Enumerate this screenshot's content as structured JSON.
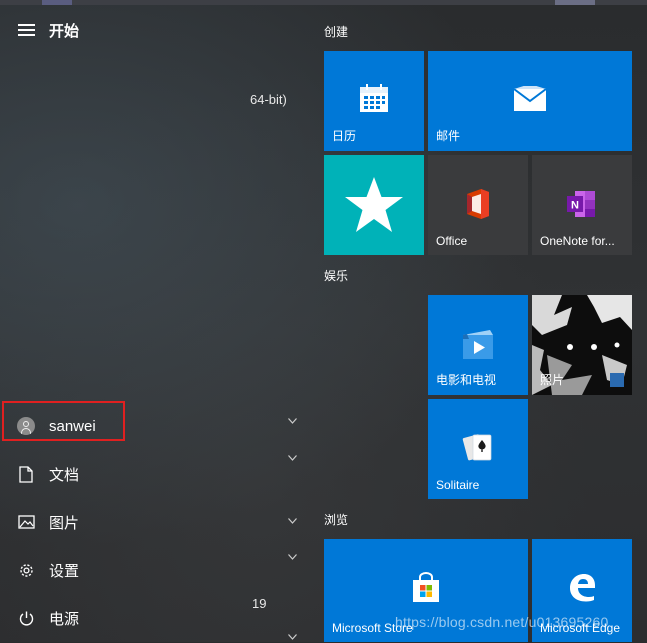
{
  "start": {
    "title": "开始"
  },
  "left_rail": {
    "user": {
      "name": "sanwei"
    },
    "documents_label": "文档",
    "pictures_label": "图片",
    "settings_label": "设置",
    "power_label": "电源"
  },
  "app_list_fragments": {
    "item1_suffix": "64-bit)",
    "item_number_fragment": "19"
  },
  "groups": {
    "create": "创建",
    "entertainment": "娱乐",
    "browse": "浏览"
  },
  "tiles": {
    "calendar": "日历",
    "mail": "邮件",
    "office": "Office",
    "onenote": "OneNote for...",
    "movies": "电影和电视",
    "solitaire": "Solitaire",
    "photos": "照片",
    "store": "Microsoft Store",
    "edge": "Microsoft Edge"
  },
  "watermark": "https://blog.csdn.net/u013695260",
  "colors": {
    "tile_blue": "#0078d7",
    "tile_teal": "#00b2b8",
    "tile_dark": "#3a3b3d",
    "highlight_red": "#e02020"
  }
}
